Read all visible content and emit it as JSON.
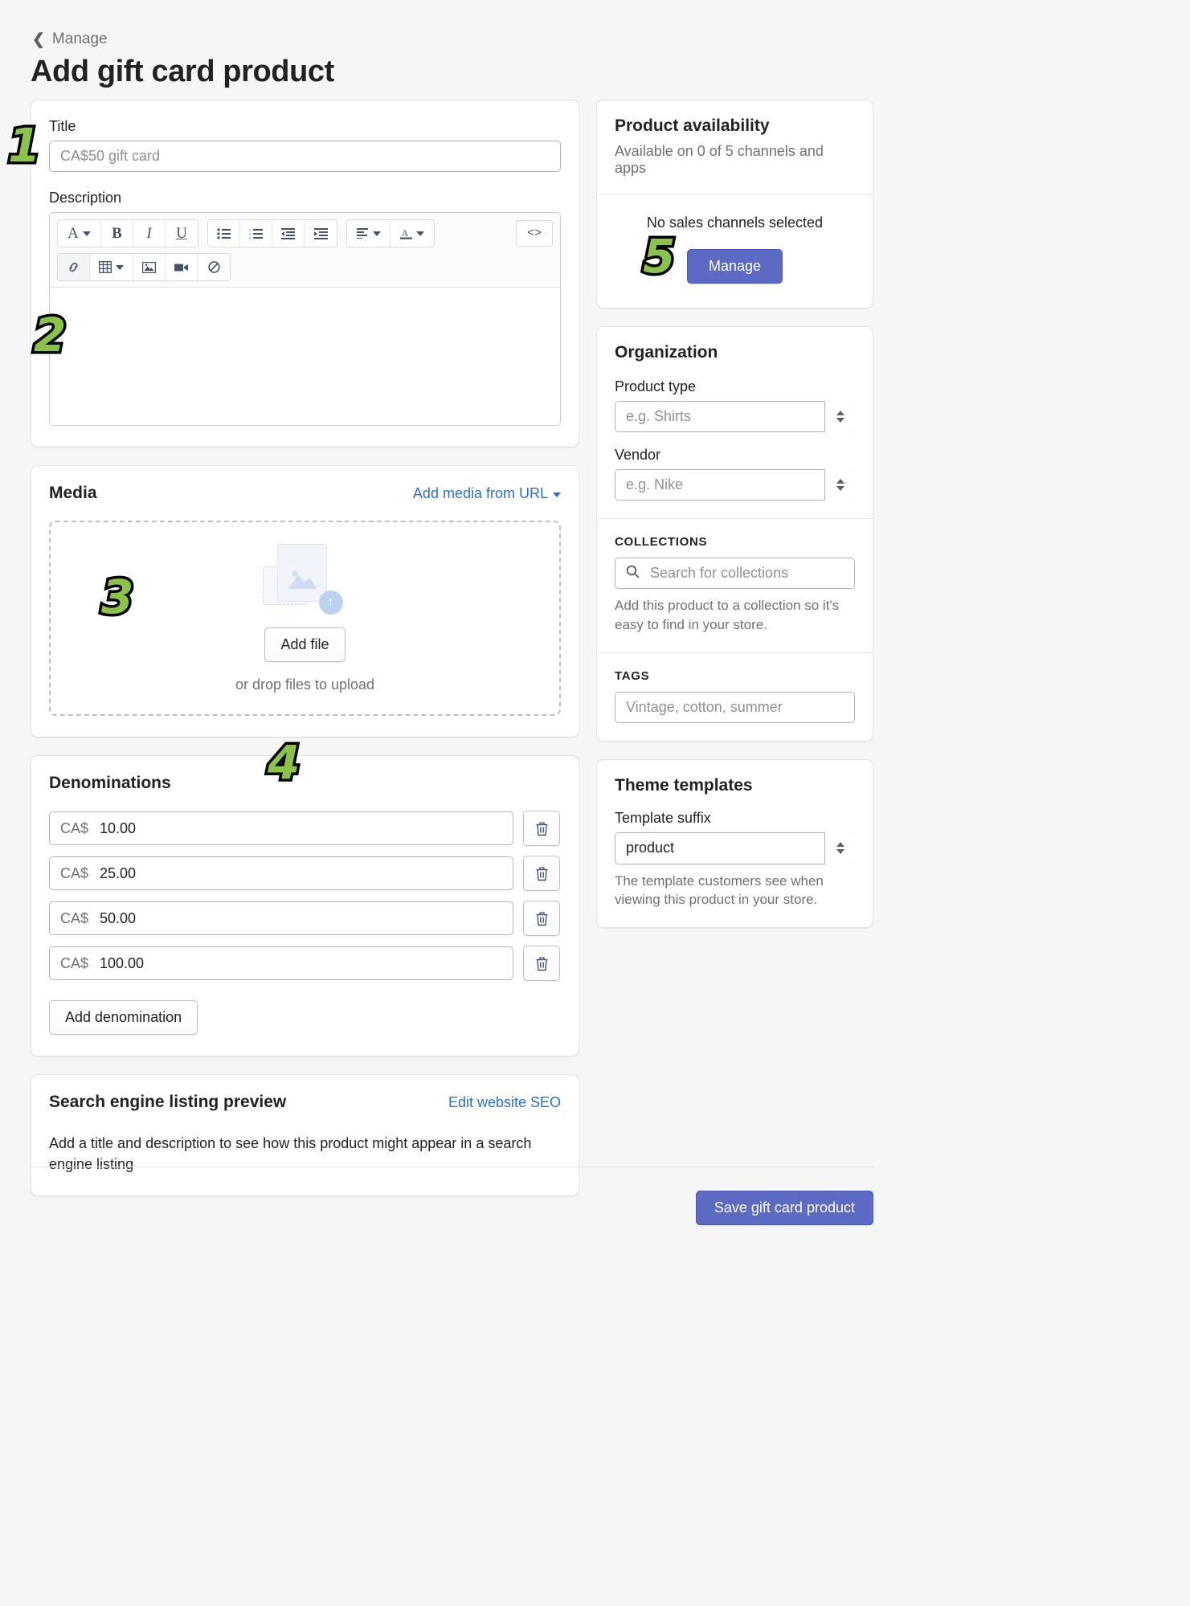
{
  "header": {
    "breadcrumb_label": "Manage",
    "back_icon": "chevron-left-icon",
    "title": "Add gift card product"
  },
  "product_form": {
    "title_label": "Title",
    "title_value": "",
    "title_placeholder": "CA$50 gift card",
    "description_label": "Description",
    "toolbar_row1": [
      {
        "name": "font-style-dropdown",
        "glyph": "A",
        "caret": true
      },
      {
        "name": "bold-button",
        "glyph": "B",
        "caret": false
      },
      {
        "name": "italic-button",
        "glyph": "I",
        "caret": false
      },
      {
        "name": "underline-button",
        "glyph": "U",
        "caret": false
      },
      {
        "name": "bulleted-list-button",
        "glyph": "list-bullet",
        "caret": false
      },
      {
        "name": "numbered-list-button",
        "glyph": "list-number",
        "caret": false
      },
      {
        "name": "outdent-button",
        "glyph": "outdent",
        "caret": false
      },
      {
        "name": "indent-button",
        "glyph": "indent",
        "caret": false
      },
      {
        "name": "align-dropdown",
        "glyph": "align-left",
        "caret": true
      },
      {
        "name": "text-color-dropdown",
        "glyph": "A-underline",
        "caret": true
      }
    ],
    "toolbar_row2": [
      {
        "name": "insert-link-button",
        "glyph": "link"
      },
      {
        "name": "insert-table-dropdown",
        "glyph": "table",
        "caret": true
      },
      {
        "name": "insert-image-button",
        "glyph": "image"
      },
      {
        "name": "insert-video-button",
        "glyph": "video"
      },
      {
        "name": "clear-formatting-button",
        "glyph": "no-entry"
      }
    ],
    "code_button_label": "<>",
    "description_value": ""
  },
  "media": {
    "title": "Media",
    "add_from_url_label": "Add media from URL",
    "add_file_label": "Add file",
    "drop_note": "or drop files to upload"
  },
  "denominations": {
    "title": "Denominations",
    "currency": "CA$",
    "rows": [
      {
        "currency": "CA$",
        "value": "10.00"
      },
      {
        "currency": "CA$",
        "value": "25.00"
      },
      {
        "currency": "CA$",
        "value": "50.00"
      },
      {
        "currency": "CA$",
        "value": "100.00"
      }
    ],
    "add_label": "Add denomination",
    "delete_icon": "trash-icon"
  },
  "seo": {
    "title": "Search engine listing preview",
    "edit_link": "Edit website SEO",
    "note": "Add a title and description to see how this product might appear in a search engine listing"
  },
  "availability": {
    "title": "Product availability",
    "subtitle": "Available on 0 of 5 channels and apps",
    "empty_message": "No sales channels selected",
    "manage_label": "Manage"
  },
  "organization": {
    "title": "Organization",
    "product_type_label": "Product type",
    "product_type_value": "",
    "product_type_placeholder": "e.g. Shirts",
    "vendor_label": "Vendor",
    "vendor_value": "",
    "vendor_placeholder": "e.g. Nike",
    "collections_caption": "COLLECTIONS",
    "collections_placeholder": "Search for collections",
    "collections_value": "",
    "collections_helper": "Add this product to a collection so it's easy to find in your store.",
    "tags_caption": "TAGS",
    "tags_placeholder": "Vintage, cotton, summer",
    "tags_value": "",
    "search_icon": "search-icon"
  },
  "theme_templates": {
    "title": "Theme templates",
    "suffix_label": "Template suffix",
    "suffix_value": "product",
    "helper": "The template customers see when viewing this product in your store."
  },
  "footer": {
    "save_label": "Save gift card product"
  },
  "annotations": [
    {
      "label": "1",
      "target": "title-field"
    },
    {
      "label": "2",
      "target": "description-editor"
    },
    {
      "label": "3",
      "target": "media-dropzone"
    },
    {
      "label": "4",
      "target": "denominations-card"
    },
    {
      "label": "5",
      "target": "sales-channels-manage"
    }
  ],
  "colors": {
    "accent": "#5c6ac4",
    "link": "#2c6ecb",
    "page_bg": "#f6f6f7",
    "card_border": "#e1e3e5",
    "annotation": "#8bc34a"
  }
}
